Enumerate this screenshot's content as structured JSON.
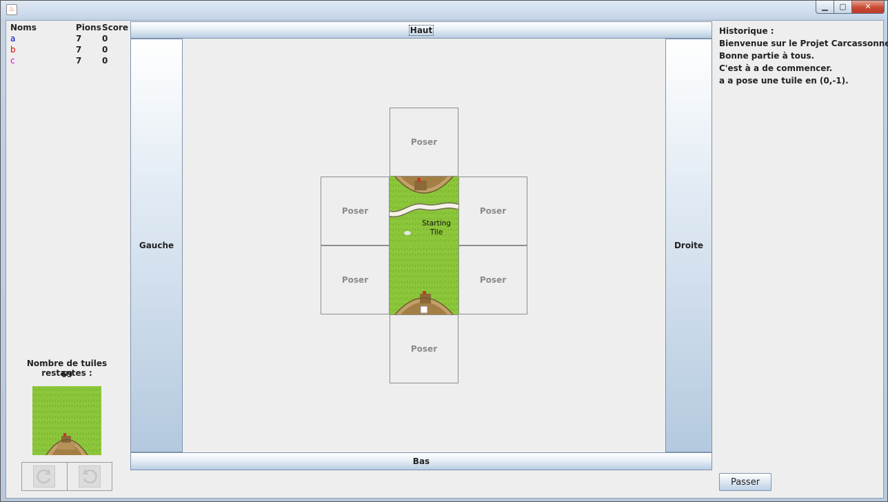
{
  "window": {
    "controls": {
      "minimize": "▁",
      "maximize": "▢",
      "close": "✕"
    },
    "app_icon": "java-cup-icon"
  },
  "players": {
    "headers": {
      "name": "Noms",
      "pawns": "Pions",
      "score": "Score"
    },
    "rows": [
      {
        "name": "a",
        "pawns": "7",
        "score": "0",
        "color": "#0000cc"
      },
      {
        "name": "b",
        "pawns": "7",
        "score": "0",
        "color": "#dd0000"
      },
      {
        "name": "c",
        "pawns": "7",
        "score": "0",
        "color": "#dd00dd"
      }
    ]
  },
  "remaining": {
    "label": "Nombre de tuiles restantes :",
    "count": "69"
  },
  "rotation": {
    "left_icon": "rotate-clockwise-icon",
    "right_icon": "rotate-counterclockwise-icon"
  },
  "board": {
    "top_label": "Haut",
    "bottom_label": "Bas",
    "left_label": "Gauche",
    "right_label": "Droite",
    "place_label": "Poser",
    "starting_tile_text": [
      "Starting",
      "Tile"
    ],
    "colors": {
      "grass": "#8cc63a",
      "grass_dark": "#6fa72a",
      "road": "#f4f1e6",
      "city": "#b08a4a"
    }
  },
  "history": {
    "title": "Historique :",
    "lines": [
      "Bienvenue sur le Projet Carcassonne !",
      "Bonne partie à tous.",
      "C'est à a de commencer.",
      "a a pose une tuile en (0,-1)."
    ]
  },
  "actions": {
    "pass_label": "Passer"
  }
}
